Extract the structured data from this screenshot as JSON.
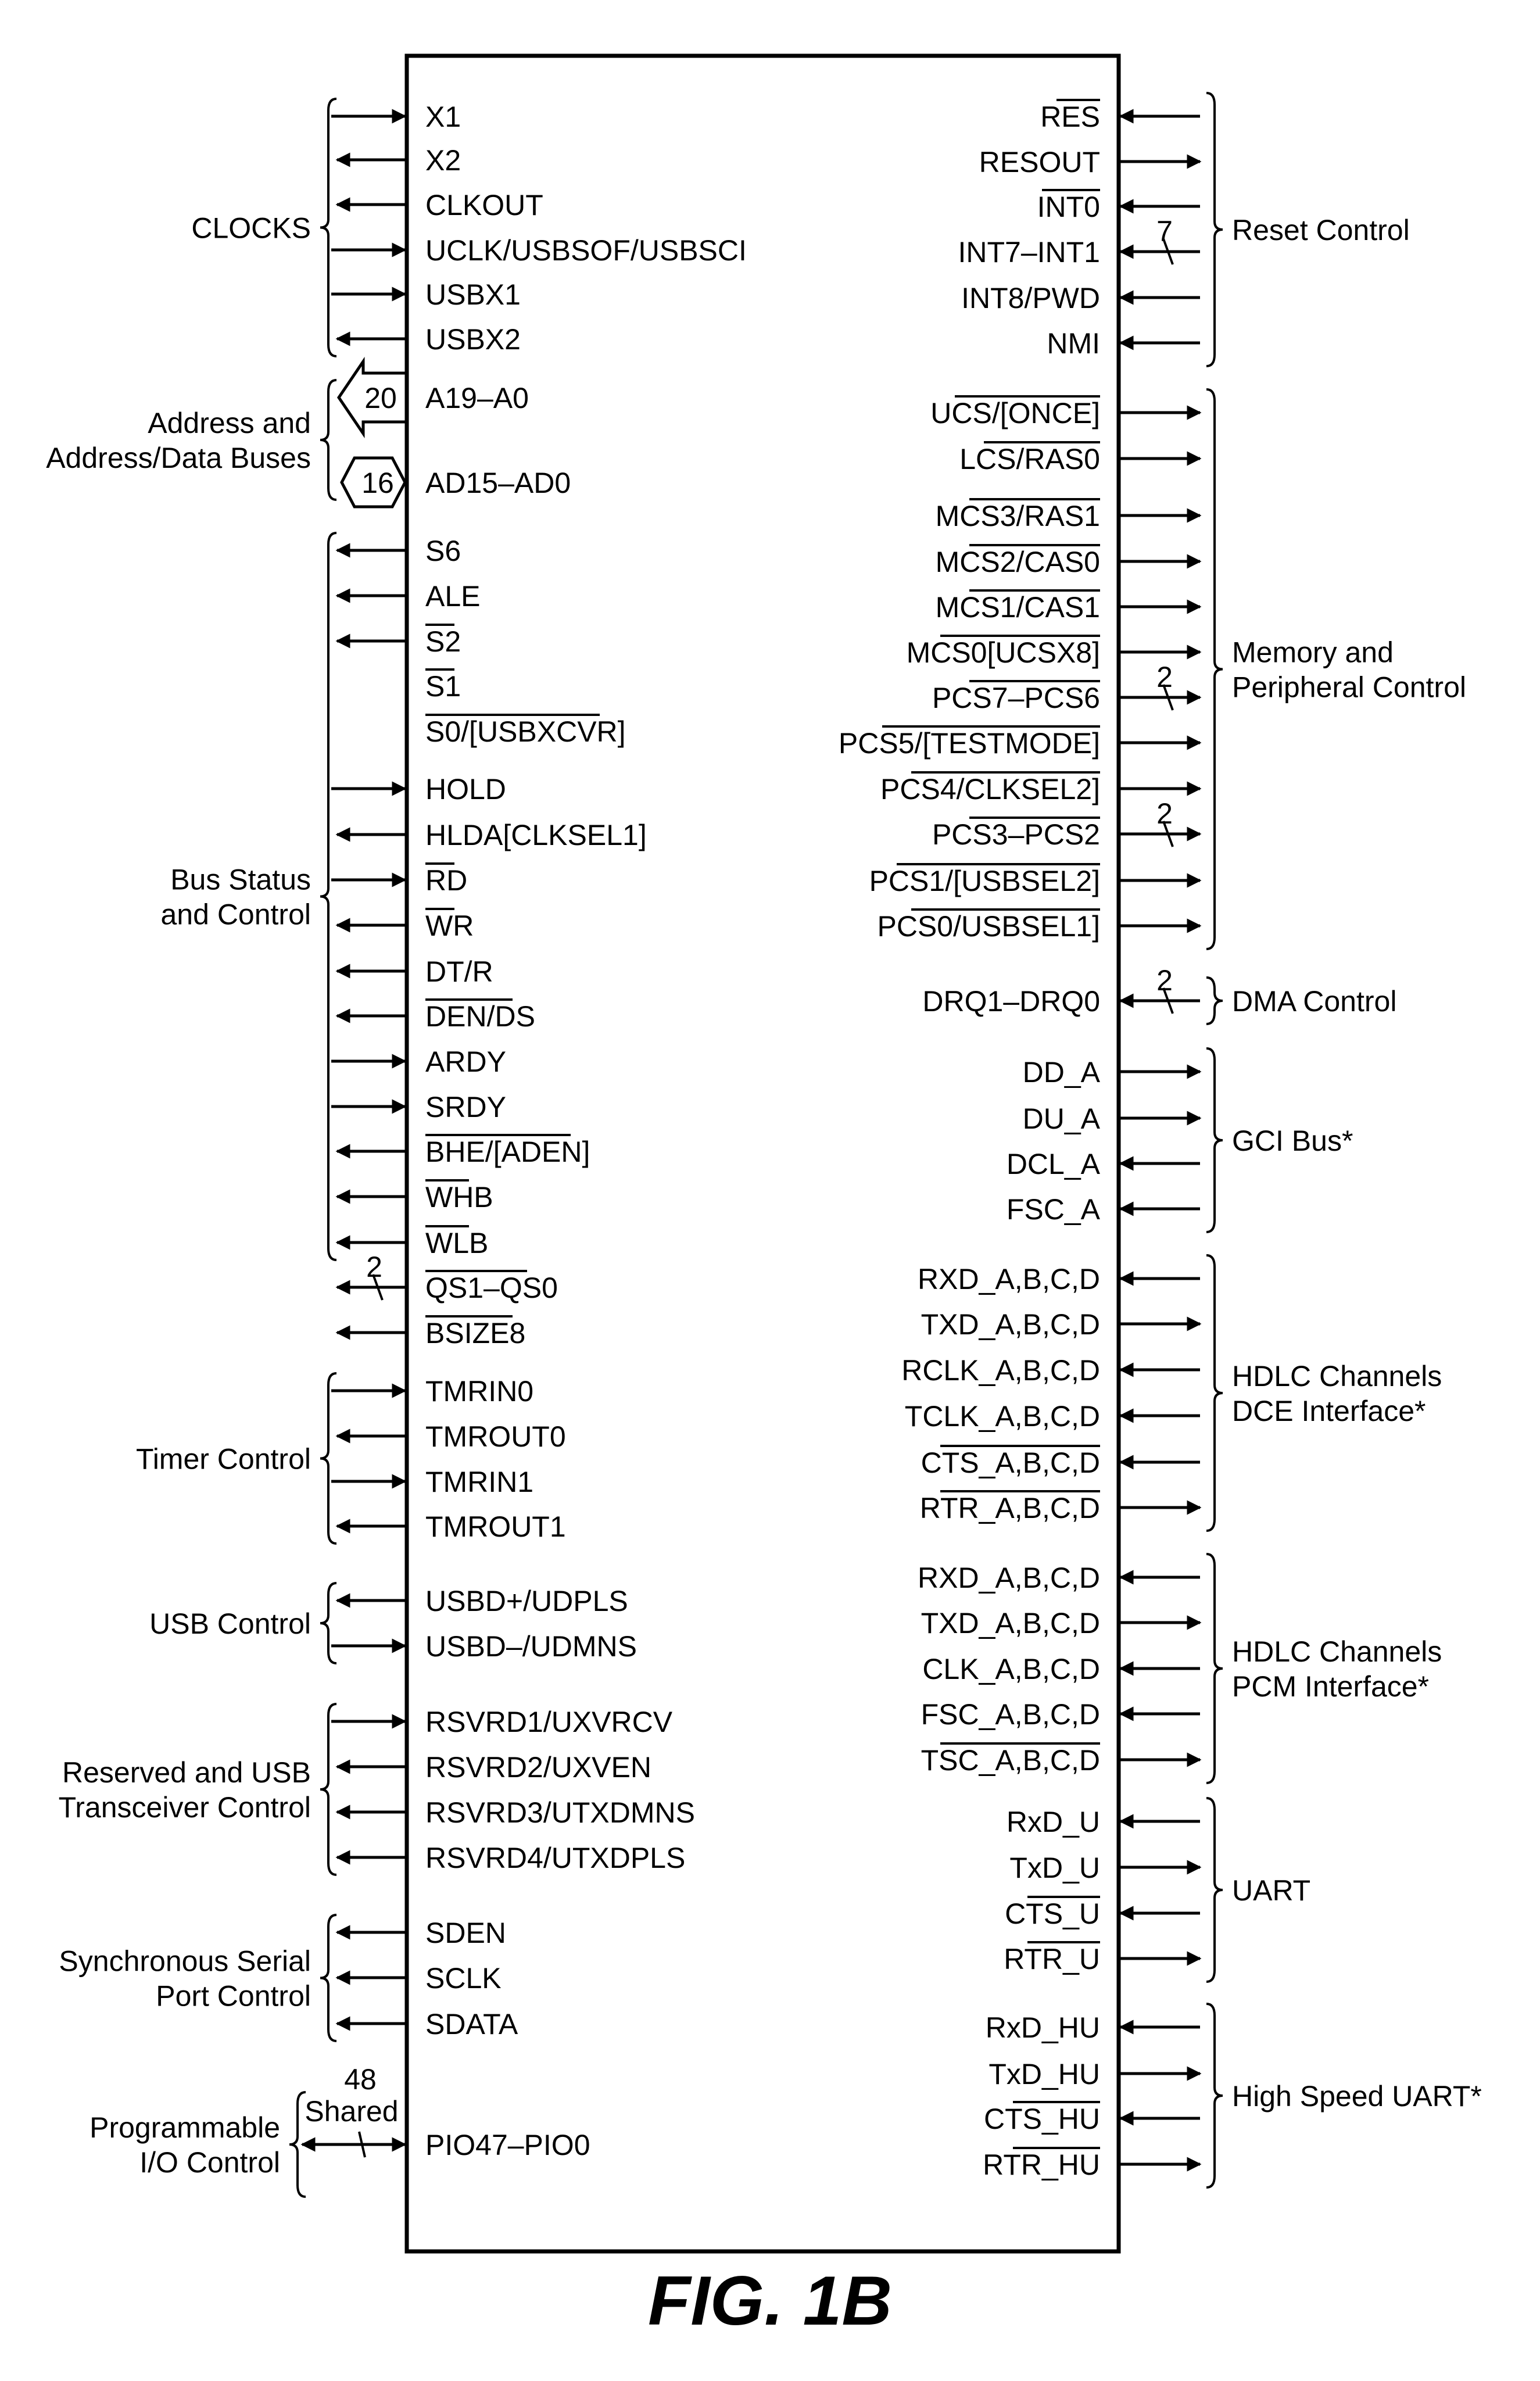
{
  "figure_title": "FIG. 1B",
  "left_pins": [
    {
      "label": "X1",
      "dir": "in"
    },
    {
      "label": "X2",
      "dir": "out"
    },
    {
      "label": "CLKOUT",
      "dir": "out"
    },
    {
      "label": "UCLK/USBSOF/USBSCI",
      "dir": "in"
    },
    {
      "label": "USBX1",
      "dir": "in"
    },
    {
      "label": "USBX2",
      "dir": "out"
    },
    {
      "label": "A19–A0",
      "dir": "bus-out",
      "width": "20"
    },
    {
      "label": "AD15–AD0",
      "dir": "bus-bi",
      "width": "16"
    },
    {
      "label": "S6",
      "dir": "out"
    },
    {
      "label": "ALE",
      "dir": "out"
    },
    {
      "label": "S2",
      "dir": "out",
      "overbar": true
    },
    {
      "label": "S1",
      "dir": "none",
      "overbar": true
    },
    {
      "label": "S0/[USBXCVR]",
      "dir": "none",
      "overbar": true
    },
    {
      "label": "HOLD",
      "dir": "in"
    },
    {
      "label": "HLDA[CLKSEL1]",
      "dir": "out"
    },
    {
      "label": "RD",
      "dir": "in",
      "overbar": true
    },
    {
      "label": "WR",
      "dir": "out",
      "overbar": true
    },
    {
      "label": "DT/R",
      "dir": "out"
    },
    {
      "label": "DEN/DS",
      "dir": "out",
      "overbar": true
    },
    {
      "label": "ARDY",
      "dir": "in"
    },
    {
      "label": "SRDY",
      "dir": "in"
    },
    {
      "label": "BHE/[ADEN]",
      "dir": "out",
      "overbar": true
    },
    {
      "label": "WHB",
      "dir": "out",
      "overbar": true
    },
    {
      "label": "WLB",
      "dir": "out",
      "overbar": true
    },
    {
      "label": "QS1–QS0",
      "dir": "out",
      "overbar": true,
      "width": "2"
    },
    {
      "label": "BSIZE8",
      "dir": "out",
      "overbar": true
    },
    {
      "label": "TMRIN0",
      "dir": "in"
    },
    {
      "label": "TMROUT0",
      "dir": "out"
    },
    {
      "label": "TMRIN1",
      "dir": "in"
    },
    {
      "label": "TMROUT1",
      "dir": "out"
    },
    {
      "label": "USBD+/UDPLS",
      "dir": "out"
    },
    {
      "label": "USBD–/UDMNS",
      "dir": "in"
    },
    {
      "label": "RSVRD1/UXVRCV",
      "dir": "in"
    },
    {
      "label": "RSVRD2/UXVEN",
      "dir": "out"
    },
    {
      "label": "RSVRD3/UTXDMNS",
      "dir": "out"
    },
    {
      "label": "RSVRD4/UTXDPLS",
      "dir": "out"
    },
    {
      "label": "SDEN",
      "dir": "out"
    },
    {
      "label": "SCLK",
      "dir": "out"
    },
    {
      "label": "SDATA",
      "dir": "out"
    },
    {
      "label": "PIO47–PIO0",
      "dir": "bi",
      "width": "48 Shared"
    }
  ],
  "left_groups": [
    {
      "label": [
        "CLOCKS"
      ],
      "from": 0,
      "to": 5
    },
    {
      "label": [
        "Address and",
        "Address/Data Buses"
      ],
      "from": 6,
      "to": 7
    },
    {
      "label": [
        "Bus Status",
        "and Control"
      ],
      "from": 8,
      "to": 23
    },
    {
      "label": [
        "Timer Control"
      ],
      "from": 26,
      "to": 29
    },
    {
      "label": [
        "USB Control"
      ],
      "from": 30,
      "to": 31
    },
    {
      "label": [
        "Reserved and USB",
        "Transceiver Control"
      ],
      "from": 32,
      "to": 35
    },
    {
      "label": [
        "Synchronous Serial",
        "Port Control"
      ],
      "from": 36,
      "to": 38
    },
    {
      "label": [
        "Programmable",
        "I/O Control"
      ],
      "from": 39,
      "to": 39
    }
  ],
  "right_pins": [
    {
      "label": "RES",
      "dir": "in",
      "overbar": true
    },
    {
      "label": "RESOUT",
      "dir": "out"
    },
    {
      "label": "INT0",
      "dir": "in",
      "overbar": true
    },
    {
      "label": "INT7–INT1",
      "dir": "in",
      "width": "7"
    },
    {
      "label": "INT8/PWD",
      "dir": "in"
    },
    {
      "label": "NMI",
      "dir": "in"
    },
    {
      "label": "UCS/[ONCE]",
      "dir": "out",
      "overbar": true
    },
    {
      "label": "LCS/RAS0",
      "dir": "out",
      "overbar": true
    },
    {
      "label": "MCS3/RAS1",
      "dir": "out",
      "overbar": true
    },
    {
      "label": "MCS2/CAS0",
      "dir": "out",
      "overbar": true
    },
    {
      "label": "MCS1/CAS1",
      "dir": "out",
      "overbar": true
    },
    {
      "label": "MCS0[UCSX8]",
      "dir": "out",
      "overbar": true
    },
    {
      "label": "PCS7–PCS6",
      "dir": "out",
      "overbar": true,
      "width": "2"
    },
    {
      "label": "PCS5/[TESTMODE]",
      "dir": "out",
      "overbar": true
    },
    {
      "label": "PCS4/CLKSEL2]",
      "dir": "out",
      "overbar": true
    },
    {
      "label": "PCS3–PCS2",
      "dir": "out",
      "overbar": true,
      "width": "2"
    },
    {
      "label": "PCS1/[USBSEL2]",
      "dir": "out",
      "overbar": true
    },
    {
      "label": "PCS0/USBSEL1]",
      "dir": "out",
      "overbar": true
    },
    {
      "label": "DRQ1–DRQ0",
      "dir": "in",
      "width": "2"
    },
    {
      "label": "DD_A",
      "dir": "out"
    },
    {
      "label": "DU_A",
      "dir": "out"
    },
    {
      "label": "DCL_A",
      "dir": "in"
    },
    {
      "label": "FSC_A",
      "dir": "in"
    },
    {
      "label": "RXD_A,B,C,D",
      "dir": "in"
    },
    {
      "label": "TXD_A,B,C,D",
      "dir": "out"
    },
    {
      "label": "RCLK_A,B,C,D",
      "dir": "in"
    },
    {
      "label": "TCLK_A,B,C,D",
      "dir": "in"
    },
    {
      "label": "CTS_A,B,C,D",
      "dir": "in",
      "overbar": true
    },
    {
      "label": "RTR_A,B,C,D",
      "dir": "out",
      "overbar": true
    },
    {
      "label": "RXD_A,B,C,D",
      "dir": "in"
    },
    {
      "label": "TXD_A,B,C,D",
      "dir": "out"
    },
    {
      "label": "CLK_A,B,C,D",
      "dir": "in"
    },
    {
      "label": "FSC_A,B,C,D",
      "dir": "in"
    },
    {
      "label": "TSC_A,B,C,D",
      "dir": "out",
      "overbar": true
    },
    {
      "label": "RxD_U",
      "dir": "in"
    },
    {
      "label": "TxD_U",
      "dir": "out"
    },
    {
      "label": "CTS_U",
      "dir": "in",
      "overbar": true
    },
    {
      "label": "RTR_U",
      "dir": "out",
      "overbar": true
    },
    {
      "label": "RxD_HU",
      "dir": "in"
    },
    {
      "label": "TxD_HU",
      "dir": "out"
    },
    {
      "label": "CTS_HU",
      "dir": "in",
      "overbar": true
    },
    {
      "label": "RTR_HU",
      "dir": "out",
      "overbar": true
    }
  ],
  "right_groups": [
    {
      "label": [
        "Reset Control"
      ],
      "from": 0,
      "to": 5
    },
    {
      "label": [
        "Memory and",
        "Peripheral Control"
      ],
      "from": 6,
      "to": 17
    },
    {
      "label": [
        "DMA Control"
      ],
      "from": 18,
      "to": 18
    },
    {
      "label": [
        "GCI Bus*"
      ],
      "from": 19,
      "to": 22
    },
    {
      "label": [
        "HDLC Channels",
        "DCE Interface*"
      ],
      "from": 23,
      "to": 28
    },
    {
      "label": [
        "HDLC Channels",
        "PCM Interface*"
      ],
      "from": 29,
      "to": 33
    },
    {
      "label": [
        "UART"
      ],
      "from": 34,
      "to": 37
    },
    {
      "label": [
        "High Speed UART*"
      ],
      "from": 38,
      "to": 41
    }
  ]
}
